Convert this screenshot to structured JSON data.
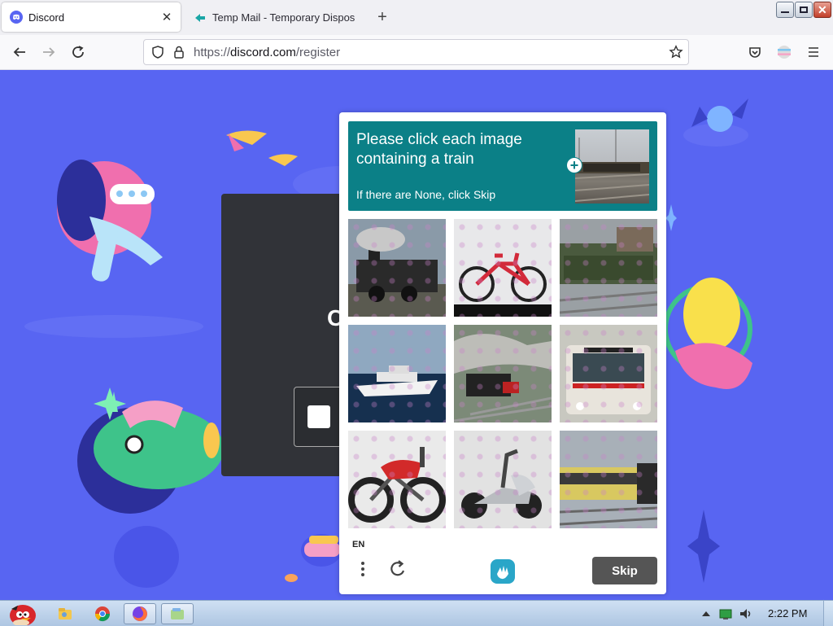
{
  "browser": {
    "tabs": [
      {
        "title": "Discord",
        "active": true
      },
      {
        "title": "Temp Mail - Temporary Disposable Email",
        "active": false
      }
    ],
    "url_scheme": "https://",
    "url_host": "discord.com",
    "url_path": "/register"
  },
  "page": {
    "card_letter": "C"
  },
  "captcha": {
    "prompt_line1": "Please click each image",
    "prompt_line2": "containing a train",
    "prompt_sub": "If there are None, click Skip",
    "tiles": [
      {
        "label": "steam train"
      },
      {
        "label": "bicycle"
      },
      {
        "label": "train"
      },
      {
        "label": "boat"
      },
      {
        "label": "steam train"
      },
      {
        "label": "bus"
      },
      {
        "label": "motorcycle"
      },
      {
        "label": "scooter"
      },
      {
        "label": "train"
      }
    ],
    "language": "EN",
    "skip_label": "Skip"
  },
  "taskbar": {
    "time": "2:22 PM"
  },
  "colors": {
    "discord_blurple": "#5865f2",
    "captcha_teal": "#0b8087",
    "skip_button": "#555555"
  }
}
